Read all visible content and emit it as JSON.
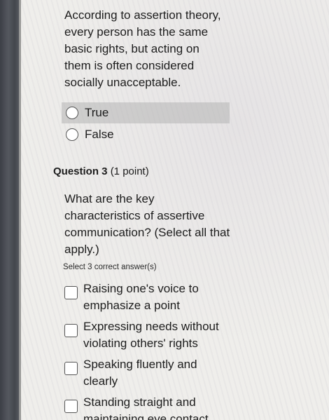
{
  "question2": {
    "text": "According to assertion theory,\nevery person has the same\nbasic rights, but acting on\nthem is often considered\nsocially unacceptable.",
    "options": [
      "True",
      "False"
    ]
  },
  "question3": {
    "label": "Question 3",
    "points": "(1 point)",
    "text": "What are the key\ncharacteristics of assertive\ncommunication? (Select all that\napply.)",
    "instructions": "Select 3 correct answer(s)",
    "options": [
      "Raising one's voice to\nemphasize a point",
      "Expressing needs without\nviolating others' rights",
      "Speaking fluently and\nclearly",
      "Standing straight and\nmaintaining eye contact"
    ]
  }
}
